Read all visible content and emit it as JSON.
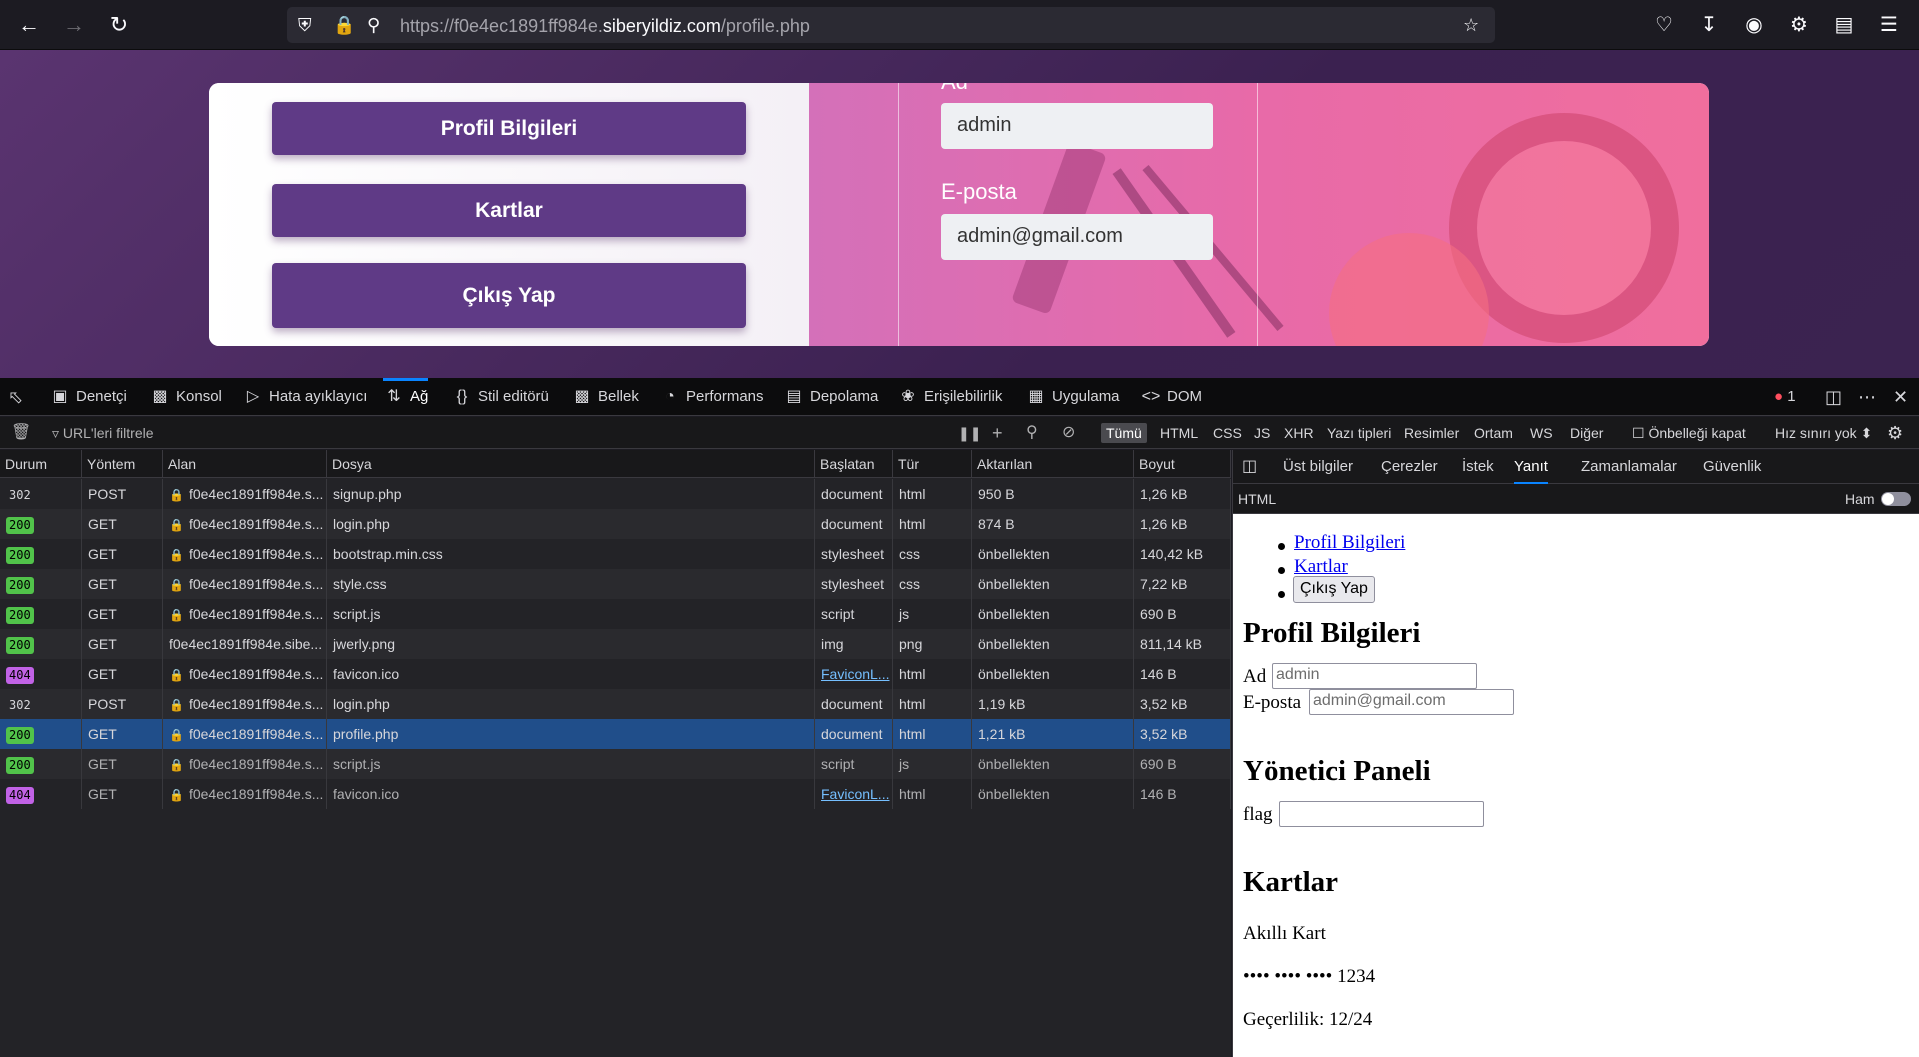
{
  "browser": {
    "url_prefix": "https://f0e4ec1891ff984e.",
    "url_domain": "siberyildiz.com",
    "url_path": "/profile.php"
  },
  "page": {
    "menu": [
      "Profil Bilgileri",
      "Kartlar",
      "Çıkış Yap"
    ],
    "name_label": "Ad",
    "name_value": "admin",
    "email_label": "E-posta",
    "email_value": "admin@gmail.com"
  },
  "devtools": {
    "tabs": [
      {
        "label": "Denetçi",
        "icon": "inspector-icon"
      },
      {
        "label": "Konsol",
        "icon": "console-icon"
      },
      {
        "label": "Hata ayıklayıcı",
        "icon": "debugger-icon"
      },
      {
        "label": "Ağ",
        "icon": "network-icon",
        "active": true
      },
      {
        "label": "Stil editörü",
        "icon": "style-editor-icon"
      },
      {
        "label": "Bellek",
        "icon": "memory-icon"
      },
      {
        "label": "Performans",
        "icon": "performance-icon"
      },
      {
        "label": "Depolama",
        "icon": "storage-icon"
      },
      {
        "label": "Erişilebilirlik",
        "icon": "accessibility-icon"
      },
      {
        "label": "Uygulama",
        "icon": "application-icon"
      },
      {
        "label": "DOM",
        "icon": "dom-icon"
      }
    ],
    "error_count": "1",
    "filter_placeholder": "URL'leri filtrele",
    "type_filters": [
      "Tümü",
      "HTML",
      "CSS",
      "JS",
      "XHR",
      "Yazı tipleri",
      "Resimler",
      "Ortam",
      "WS",
      "Diğer"
    ],
    "disable_cache_label": "Önbelleği kapat",
    "throttle_label": "Hız sınırı yok ⬍",
    "columns": [
      "Durum",
      "Yöntem",
      "Alan",
      "Dosya",
      "Başlatan",
      "Tür",
      "Aktarılan",
      "Boyut"
    ],
    "requests": [
      {
        "status": "302",
        "method": "POST",
        "domain": "f0e4ec1891ff984e.s...",
        "file": "signup.php",
        "initiator": "document",
        "type": "html",
        "transferred": "950 B",
        "size": "1,26 kB"
      },
      {
        "status": "200",
        "method": "GET",
        "domain": "f0e4ec1891ff984e.s...",
        "file": "login.php",
        "initiator": "document",
        "type": "html",
        "transferred": "874 B",
        "size": "1,26 kB"
      },
      {
        "status": "200",
        "method": "GET",
        "domain": "f0e4ec1891ff984e.s...",
        "file": "bootstrap.min.css",
        "initiator": "stylesheet",
        "type": "css",
        "transferred": "önbellekten",
        "size": "140,42 kB"
      },
      {
        "status": "200",
        "method": "GET",
        "domain": "f0e4ec1891ff984e.s...",
        "file": "style.css",
        "initiator": "stylesheet",
        "type": "css",
        "transferred": "önbellekten",
        "size": "7,22 kB"
      },
      {
        "status": "200",
        "method": "GET",
        "domain": "f0e4ec1891ff984e.s...",
        "file": "script.js",
        "initiator": "script",
        "type": "js",
        "transferred": "önbellekten",
        "size": "690 B"
      },
      {
        "status": "200",
        "method": "GET",
        "domain": "f0e4ec1891ff984e.sibe...",
        "file": "jwerly.png",
        "initiator": "img",
        "type": "png",
        "transferred": "önbellekten",
        "size": "811,14 kB"
      },
      {
        "status": "404",
        "method": "GET",
        "domain": "f0e4ec1891ff984e.s...",
        "file": "favicon.ico",
        "initiator": "FaviconL...",
        "type": "html",
        "transferred": "önbellekten",
        "size": "146 B"
      },
      {
        "status": "302",
        "method": "POST",
        "domain": "f0e4ec1891ff984e.s...",
        "file": "login.php",
        "initiator": "document",
        "type": "html",
        "transferred": "1,19 kB",
        "size": "3,52 kB"
      },
      {
        "status": "200",
        "method": "GET",
        "domain": "f0e4ec1891ff984e.s...",
        "file": "profile.php",
        "initiator": "document",
        "type": "html",
        "transferred": "1,21 kB",
        "size": "3,52 kB"
      },
      {
        "status": "200",
        "method": "GET",
        "domain": "f0e4ec1891ff984e.s...",
        "file": "script.js",
        "initiator": "script",
        "type": "js",
        "transferred": "önbellekten",
        "size": "690 B"
      },
      {
        "status": "404",
        "method": "GET",
        "domain": "f0e4ec1891ff984e.s...",
        "file": "favicon.ico",
        "initiator": "FaviconL...",
        "type": "html",
        "transferred": "önbellekten",
        "size": "146 B"
      }
    ],
    "selected_index": 8,
    "side_tabs": [
      "Üst bilgiler",
      "Çerezler",
      "İstek",
      "Yanıt",
      "Zamanlamalar",
      "Güvenlik"
    ],
    "side_active": "Yanıt",
    "side_sub_label": "HTML",
    "raw_label": "Ham",
    "response": {
      "links": [
        "Profil Bilgileri",
        "Kartlar"
      ],
      "button": "Çıkış Yap",
      "h_profile": "Profil Bilgileri",
      "ad_label": "Ad",
      "ad_value": "admin",
      "eposta_label": "E-posta",
      "eposta_value": "admin@gmail.com",
      "h_admin": "Yönetici Paneli",
      "flag_label": "flag",
      "h_cards": "Kartlar",
      "card_name": "Akıllı Kart",
      "card_number": "•••• •••• •••• 1234",
      "card_expiry": "Geçerlilik: 12/24"
    }
  }
}
